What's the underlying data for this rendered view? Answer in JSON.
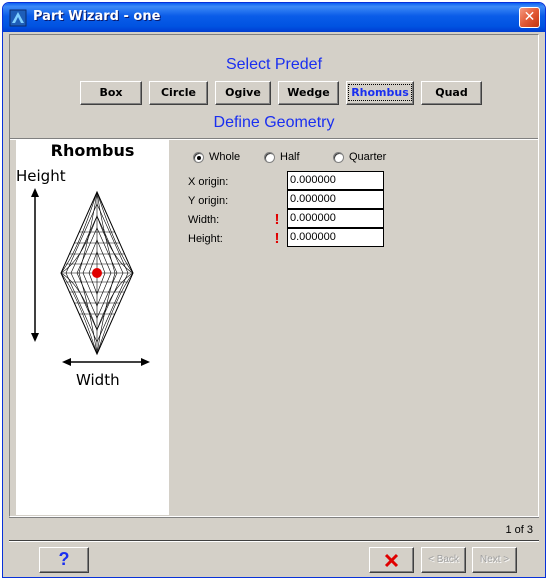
{
  "window": {
    "title": "Part Wizard - one",
    "close_glyph": "✕",
    "titlebar_color": "#0a5ce8"
  },
  "predef": {
    "heading": "Select Predef",
    "buttons": [
      {
        "label": "Box",
        "active": false
      },
      {
        "label": "Circle",
        "active": false
      },
      {
        "label": "Ogive",
        "active": false
      },
      {
        "label": "Wedge",
        "active": false
      },
      {
        "label": "Rhombus",
        "active": true
      },
      {
        "label": "Quad",
        "active": false
      }
    ]
  },
  "geometry": {
    "heading": "Define Geometry",
    "shape_name": "Rhombus",
    "height_label": "Height",
    "width_label": "Width",
    "center_color": "#e00000"
  },
  "options": {
    "whole": "Whole",
    "half": "Half",
    "quarter": "Quarter",
    "selected": "Whole"
  },
  "fields": {
    "x_origin": {
      "label": "X origin:",
      "value": "0.000000"
    },
    "y_origin": {
      "label": "Y origin:",
      "value": "0.000000"
    },
    "width": {
      "label": "Width:",
      "value": "0.000000",
      "required": true
    },
    "height": {
      "label": "Height:",
      "value": "0.000000",
      "required": true
    }
  },
  "status": {
    "page_indicator": "1 of 3"
  },
  "footer": {
    "help_label": "?",
    "back_label": "Back",
    "next_label": "Next",
    "accent_color": "#1a2ff0"
  }
}
